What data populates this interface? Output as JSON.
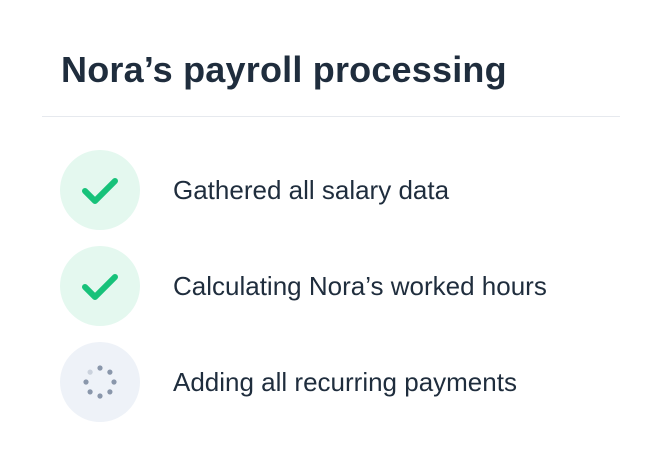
{
  "title": "Nora’s payroll processing",
  "colors": {
    "text": "#1f2d3d",
    "done_bg": "#e4f8ef",
    "done_check": "#17c27a",
    "loading_bg": "#eef2f8",
    "loading_dots": "#8a97ab",
    "divider": "#e6e9ee"
  },
  "steps": [
    {
      "label": "Gathered all salary data",
      "status": "done",
      "icon": "check-icon"
    },
    {
      "label": "Calculating Nora’s worked hours",
      "status": "done",
      "icon": "check-icon"
    },
    {
      "label": "Adding all recurring payments",
      "status": "in-progress",
      "icon": "spinner-icon"
    }
  ]
}
